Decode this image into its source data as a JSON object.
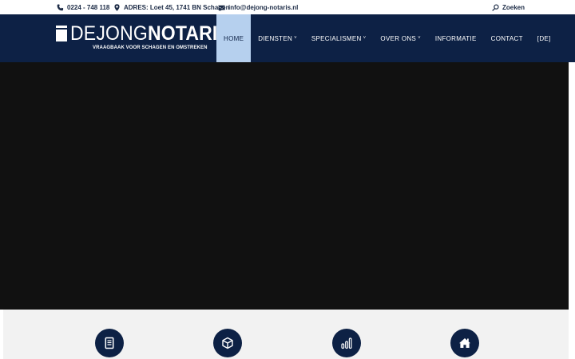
{
  "topbar": {
    "phone": "0224 - 748 118",
    "address": "ADRES: Loet 45, 1741 BN Schagen",
    "email": "info@dejong-notaris.nl",
    "search_label": "Zoeken"
  },
  "logo": {
    "name_light": "DEJONG",
    "name_bold": "NOTARIS",
    "tagline": "VRAAGBAAK VOOR SCHAGEN EN OMSTREKEN"
  },
  "nav": {
    "items": [
      {
        "label": "HOME",
        "active": true,
        "has_submenu": false
      },
      {
        "label": "DIENSTEN",
        "active": false,
        "has_submenu": true
      },
      {
        "label": "SPECIALISMEN",
        "active": false,
        "has_submenu": true
      },
      {
        "label": "OVER ONS",
        "active": false,
        "has_submenu": true
      },
      {
        "label": "INFORMATIE",
        "active": false,
        "has_submenu": false
      },
      {
        "label": "CONTACT",
        "active": false,
        "has_submenu": false
      },
      {
        "label": "[DE]",
        "active": false,
        "has_submenu": false
      }
    ],
    "submenu_glyph": "˅"
  },
  "features": {
    "icons": [
      "document-icon",
      "box-icon",
      "bar-chart-icon",
      "home-icon"
    ]
  },
  "colors": {
    "brand_navy": "#0d2145",
    "nav_active": "#b6d0ee",
    "hero_bg": "#111111",
    "features_bg": "#f2f2f2"
  }
}
